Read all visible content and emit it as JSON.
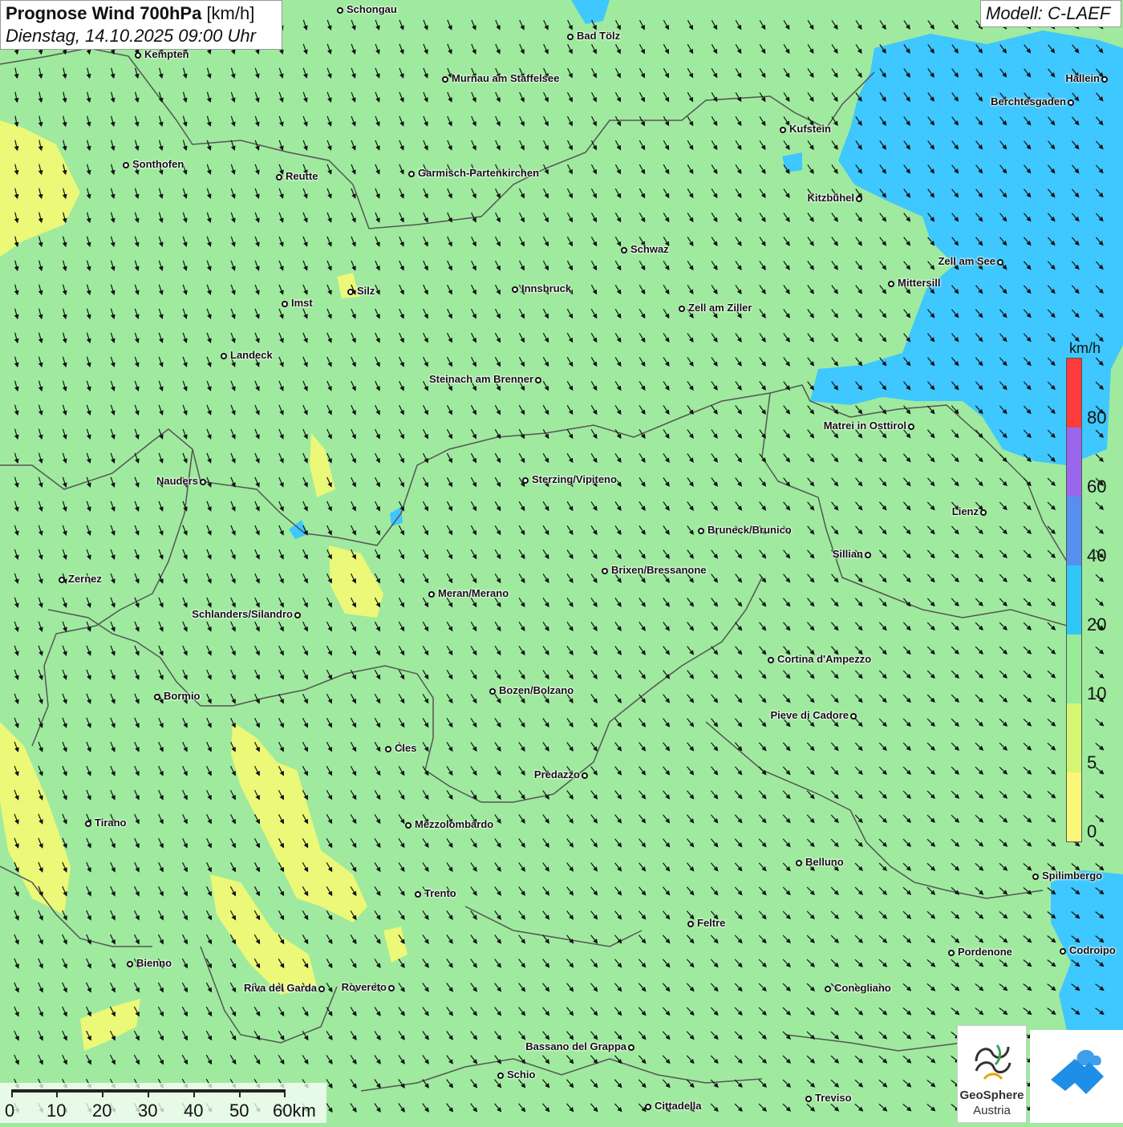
{
  "header": {
    "title_bold": "Prognose Wind 700hPa",
    "title_unit": "[km/h]",
    "datetime": "Dienstag, 14.10.2025 09:00 Uhr",
    "model": "Modell: C-LAEF"
  },
  "legend": {
    "unit": "km/h",
    "labels": [
      "80",
      "60",
      "40",
      "20",
      "10",
      "5",
      "0"
    ],
    "colors": {
      "red": "#ff3b3b",
      "purple": "#9a66ee",
      "blue": "#5590ee",
      "cyan": "#2ec7f7",
      "green": "#97ec97",
      "yellowgreen": "#d6f772",
      "yellow": "#fbf877"
    }
  },
  "scale": {
    "labels": [
      "0",
      "10",
      "20",
      "30",
      "40",
      "50",
      "60km"
    ]
  },
  "logos": {
    "geosphere_name": "GeoSphere",
    "geosphere_sub": "Austria"
  },
  "map_colors": {
    "base": "#9fea9f",
    "calm": "#ecf877",
    "strong": "#3fc7ff",
    "border": "#555555",
    "arrow": "#111111"
  },
  "cities": [
    {
      "name": "Schongau",
      "side": "r"
    },
    {
      "name": "Bad Tölz",
      "side": "r"
    },
    {
      "name": "Kempten",
      "side": "r"
    },
    {
      "name": "Murnau am Staffelsee",
      "side": "r"
    },
    {
      "name": "Hallein",
      "side": "l"
    },
    {
      "name": "Berchtesgaden",
      "side": "l"
    },
    {
      "name": "Kufstein",
      "side": "r"
    },
    {
      "name": "Sonthofen",
      "side": "r"
    },
    {
      "name": "Reutte",
      "side": "r"
    },
    {
      "name": "Garmisch-Partenkirchen",
      "side": "r"
    },
    {
      "name": "Kitzbühel",
      "side": "l"
    },
    {
      "name": "Schwaz",
      "side": "r"
    },
    {
      "name": "Zell am See",
      "side": "l"
    },
    {
      "name": "Mittersill",
      "side": "r"
    },
    {
      "name": "Silz",
      "side": "r"
    },
    {
      "name": "Innsbruck",
      "side": "r"
    },
    {
      "name": "Imst",
      "side": "r"
    },
    {
      "name": "Zell am Ziller",
      "side": "r"
    },
    {
      "name": "Landeck",
      "side": "r"
    },
    {
      "name": "Steinach am Brenner",
      "side": "l"
    },
    {
      "name": "Matrei in Osttirol",
      "side": "l"
    },
    {
      "name": "Nauders",
      "side": "l"
    },
    {
      "name": "Sterzing/Vipiteno",
      "side": "r"
    },
    {
      "name": "Lienz",
      "side": "l"
    },
    {
      "name": "Bruneck/Brunico",
      "side": "r"
    },
    {
      "name": "Sillian",
      "side": "l"
    },
    {
      "name": "Brixen/Bressanone",
      "side": "r"
    },
    {
      "name": "Zernez",
      "side": "r"
    },
    {
      "name": "Meran/Merano",
      "side": "r"
    },
    {
      "name": "Schlanders/Silandro",
      "side": "l"
    },
    {
      "name": "Cortina d'Ampezzo",
      "side": "r"
    },
    {
      "name": "Bozen/Bolzano",
      "side": "r"
    },
    {
      "name": "Bormio",
      "side": "r"
    },
    {
      "name": "Pieve di Cadore",
      "side": "l"
    },
    {
      "name": "Cles",
      "side": "r"
    },
    {
      "name": "Predazzo",
      "side": "l"
    },
    {
      "name": "Tirano",
      "side": "r"
    },
    {
      "name": "Mezzolombardo",
      "side": "r"
    },
    {
      "name": "Belluno",
      "side": "r"
    },
    {
      "name": "Spilimbergo",
      "side": "r"
    },
    {
      "name": "Trento",
      "side": "r"
    },
    {
      "name": "Feltre",
      "side": "r"
    },
    {
      "name": "Pordenone",
      "side": "r"
    },
    {
      "name": "Codroipo",
      "side": "r"
    },
    {
      "name": "Bienno",
      "side": "r"
    },
    {
      "name": "Riva del Garda",
      "side": "l"
    },
    {
      "name": "Rovereto",
      "side": "l"
    },
    {
      "name": "Conegliano",
      "side": "r"
    },
    {
      "name": "Bassano del Grappa",
      "side": "l"
    },
    {
      "name": "Schio",
      "side": "r"
    },
    {
      "name": "Treviso",
      "side": "r"
    },
    {
      "name": "Cittadella",
      "side": "r"
    }
  ]
}
